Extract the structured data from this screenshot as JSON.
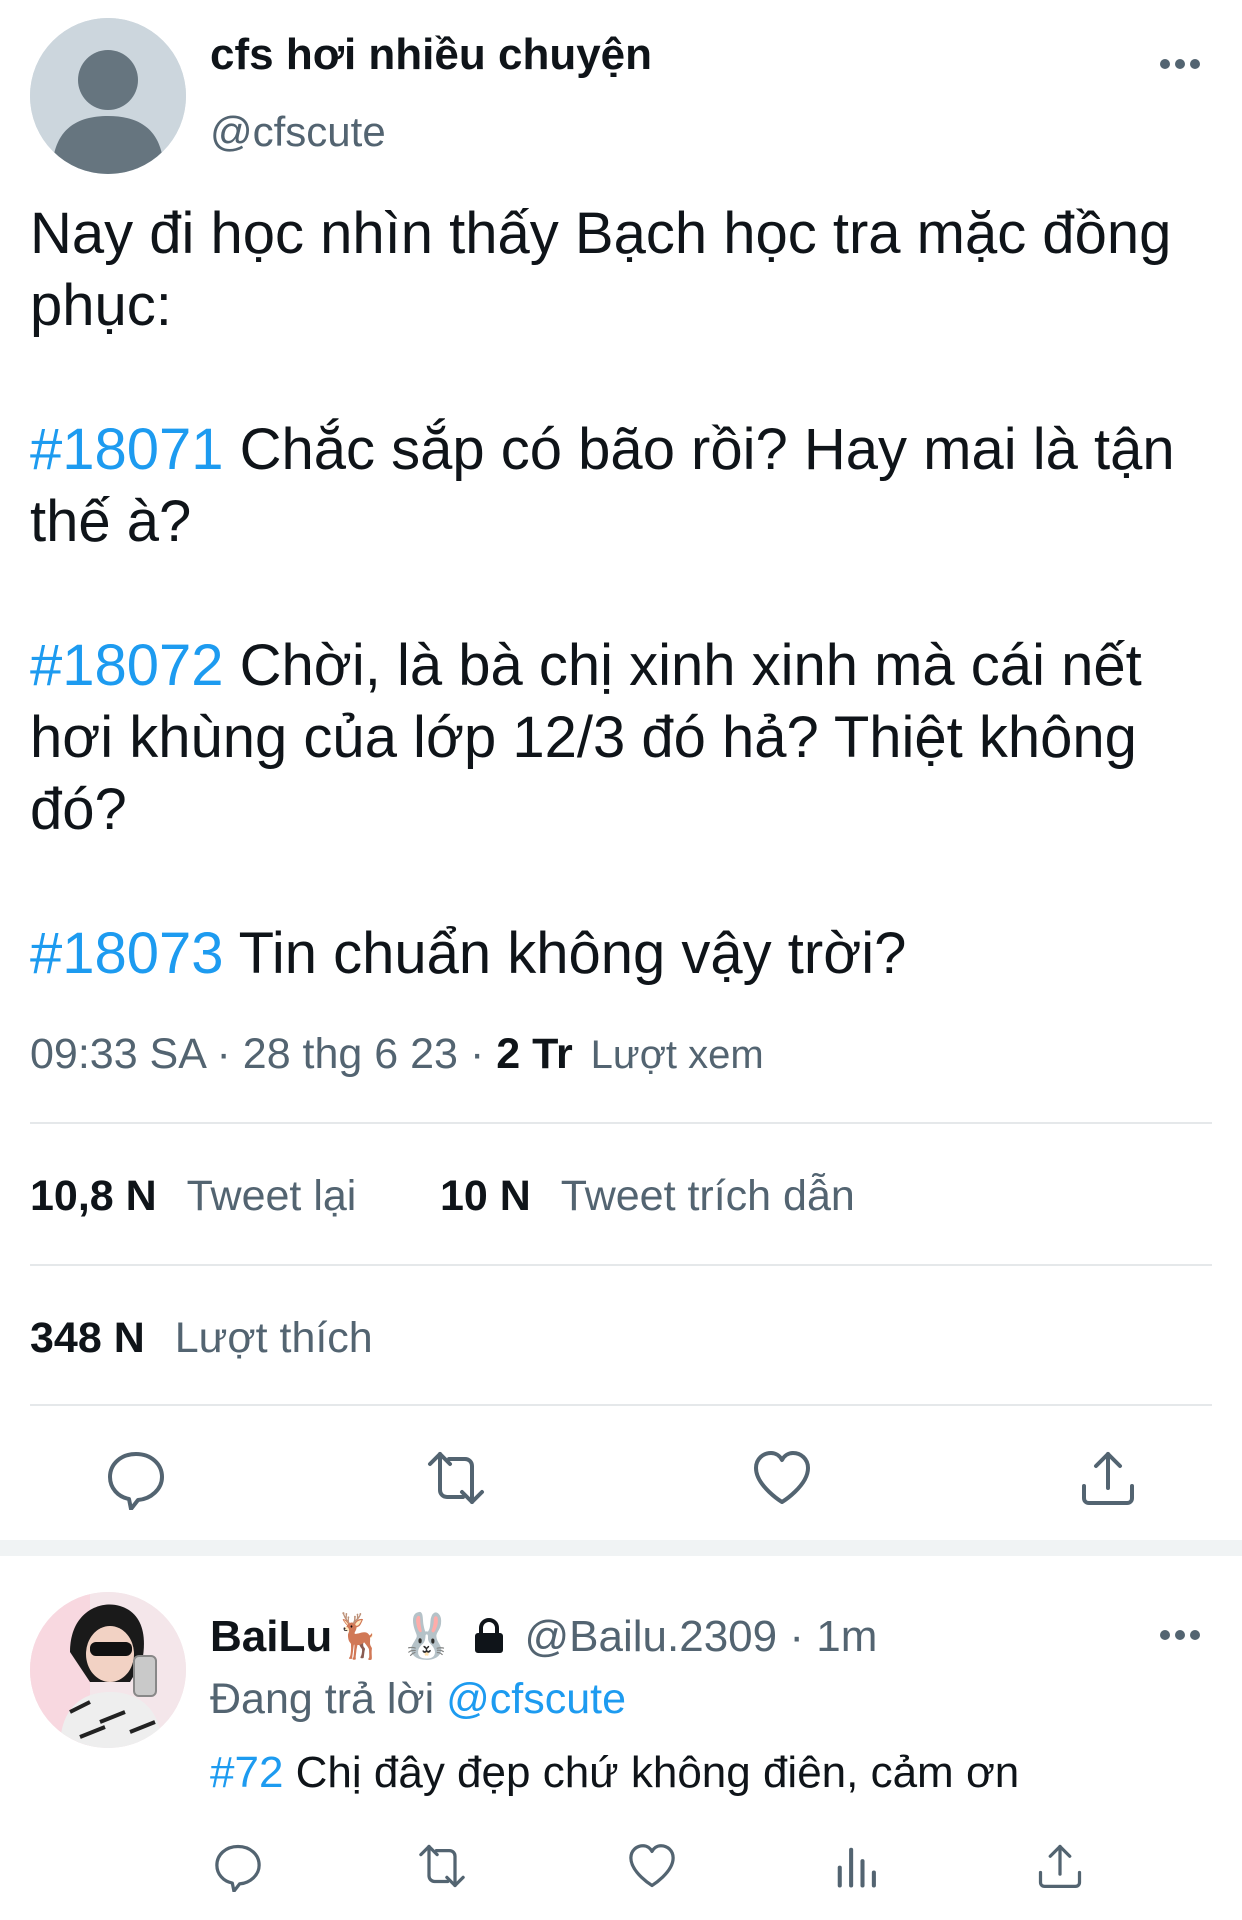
{
  "tweet": {
    "display_name": "cfs hơi nhiều chuyện",
    "handle": "@cfscute",
    "body": [
      {
        "text": "Nay đi học nhìn thấy Bạch học tra mặc đồng phục:"
      },
      {
        "tag": "#18071",
        "text": " Chắc sắp có bão rồi? Hay mai là tận thế à?"
      },
      {
        "tag": "#18072",
        "text": " Chời, là bà chị xinh xinh mà cái nết hơi khùng của lớp 12/3 đó hả? Thiệt không đó?"
      },
      {
        "tag": "#18073",
        "text": " Tin chuẩn không vậy trời?"
      }
    ],
    "time": "09:33 SA",
    "date": "28 thg 6 23",
    "views_count": "2 Tr",
    "views_label": "Lượt xem",
    "retweets_count": "10,8 N",
    "retweets_label": "Tweet lại",
    "quotes_count": "10 N",
    "quotes_label": "Tweet trích dẫn",
    "likes_count": "348 N",
    "likes_label": "Lượt thích"
  },
  "reply": {
    "display_name": "BaiLu",
    "name_emojis": "🦌 🐰",
    "handle": "@Bailu.2309",
    "time": "1m",
    "replying_prefix": "Đang trả lời",
    "replying_to": "@cfscute",
    "tag": "#72",
    "text": " Chị đây đẹp chứ không điên, cảm ơn"
  },
  "icons": {
    "main_actions": [
      "reply-icon",
      "retweet-icon",
      "like-icon",
      "share-icon"
    ],
    "reply_actions": [
      "reply-icon",
      "retweet-icon",
      "like-icon",
      "analytics-icon",
      "share-icon"
    ]
  },
  "colors": {
    "accent": "#1d9bf0",
    "secondary_text": "#536471",
    "divider": "#e5e8ea"
  }
}
